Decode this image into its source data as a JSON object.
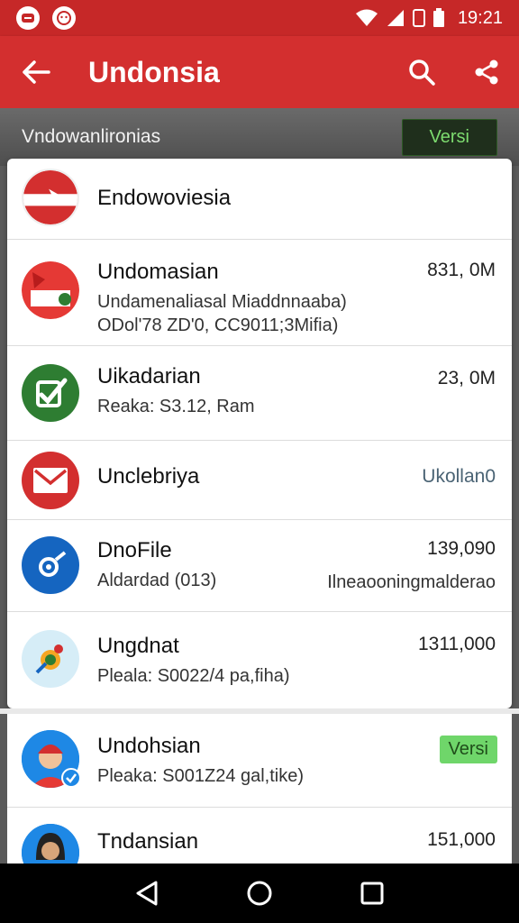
{
  "status_bar": {
    "time": "19:21"
  },
  "app_bar": {
    "title": "Undonsia"
  },
  "section": {
    "title": "Vndowanlironias",
    "button": "Versi"
  },
  "rows": [
    {
      "name": "Endowoviesia",
      "sub1": "",
      "sub2": "",
      "value": ""
    },
    {
      "name": "Undomasian",
      "sub1": "Undamenaliasal Miaddnnaaba)",
      "sub2": "ODol'78 ZD'0, CC9011;3Mifia)",
      "value": "831, 0M"
    },
    {
      "name": "Uikadarian",
      "sub1": "Reaka: S3.12, Ram",
      "sub2": "",
      "value": "23, 0M"
    },
    {
      "name": "Unclebriya",
      "sub1": "",
      "sub2": "",
      "value": "Ukollan0"
    },
    {
      "name": "DnoFile",
      "sub1": "Aldardad (013)",
      "sub2": "",
      "value": "139,090",
      "value2": "Ilneaooningmalderao"
    },
    {
      "name": "Ungdnat",
      "sub1": "Pleala: S0022/4 pa,fiha)",
      "sub2": "",
      "value": "1311,000"
    }
  ],
  "rows2": [
    {
      "name": "Undohsian",
      "sub1": "Pleaka: S001Z24 gal,tike)",
      "badge": "Versi"
    },
    {
      "name": "Tndansian",
      "sub1": "",
      "value": "151,000"
    }
  ],
  "colors": {
    "primary": "#d32f2f",
    "status": "#c62828",
    "accent_green": "#6fd66a"
  }
}
